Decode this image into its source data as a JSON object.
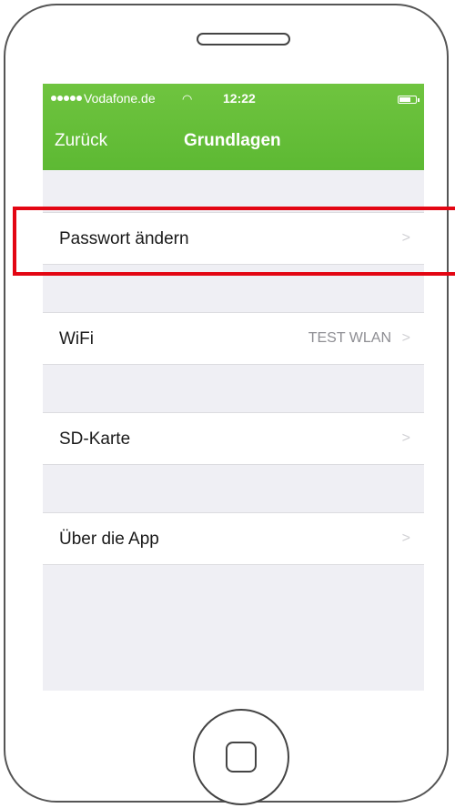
{
  "status_bar": {
    "carrier": "Vodafone.de",
    "wifi_icon": "wifi-icon",
    "time": "12:22",
    "battery_icon": "battery-icon"
  },
  "nav": {
    "back_label": "Zurück",
    "title": "Grundlagen"
  },
  "rows": [
    {
      "label": "Passwort ändern",
      "value": "",
      "icon": "chevron-right-icon"
    },
    {
      "label": "WiFi",
      "value": "TEST WLAN",
      "icon": "chevron-right-icon"
    },
    {
      "label": "SD-Karte",
      "value": "",
      "icon": "chevron-right-icon"
    },
    {
      "label": "Über die App",
      "value": "",
      "icon": "chevron-right-icon"
    }
  ],
  "colors": {
    "nav_green": "#5db933",
    "highlight_red": "#e30613",
    "screen_background": "#efeff4"
  },
  "device": {
    "speaker_icon": "speaker-slot-icon",
    "home_icon": "home-button-icon"
  }
}
